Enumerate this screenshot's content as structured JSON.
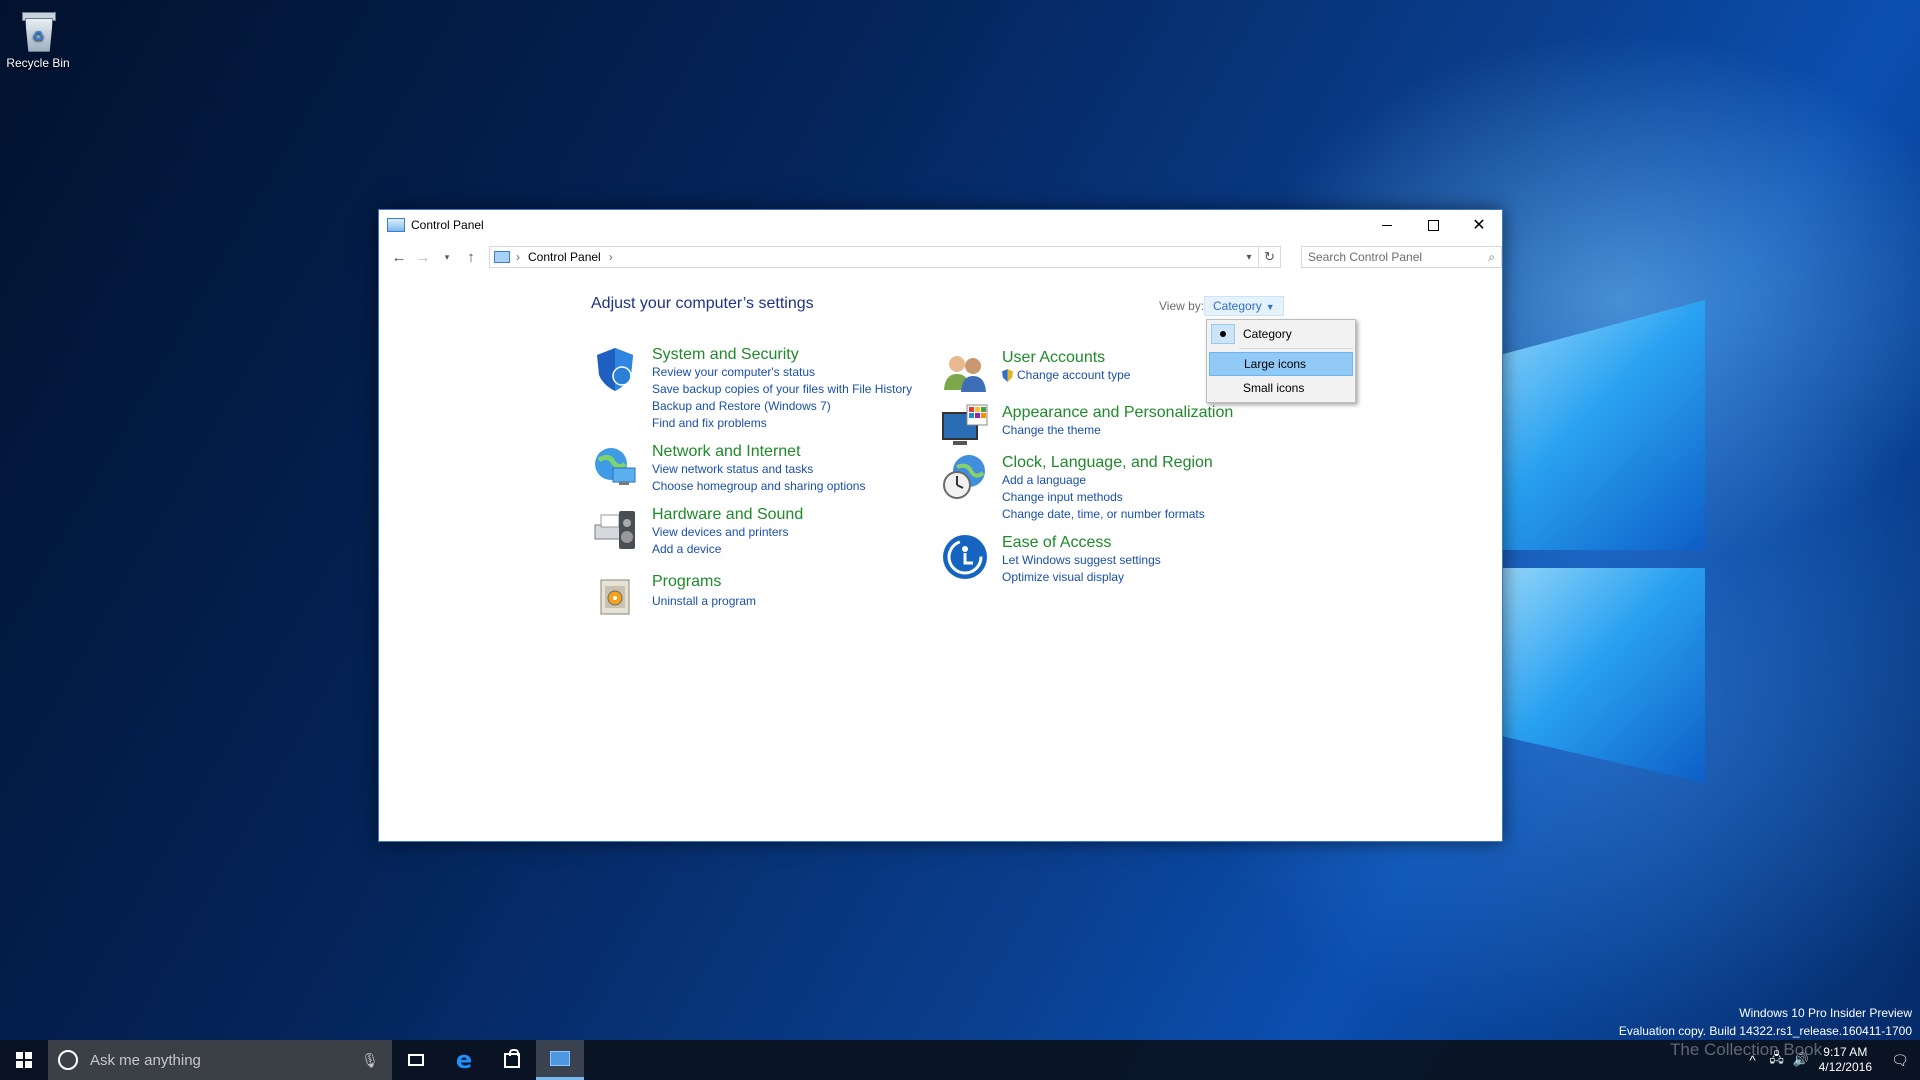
{
  "desktop": {
    "icons": [
      {
        "label": "Recycle Bin",
        "icon": "recycle-bin-icon"
      }
    ]
  },
  "window": {
    "title": "Control Panel",
    "search_placeholder": "Search Control Panel",
    "breadcrumb": [
      "Control Panel"
    ],
    "heading": "Adjust your computer’s settings",
    "view_by_label": "View by:",
    "view_by_value": "Category"
  },
  "categories": [
    {
      "title": "System and Security",
      "icon": "shield-icon",
      "links": [
        "Review your computer's status",
        "Save backup copies of your files with File History",
        "Backup and Restore (Windows 7)",
        "Find and fix problems"
      ]
    },
    {
      "title": "Network and Internet",
      "icon": "globe-network-icon",
      "links": [
        "View network status and tasks",
        "Choose homegroup and sharing options"
      ]
    },
    {
      "title": "Hardware and Sound",
      "icon": "printer-speaker-icon",
      "links": [
        "View devices and printers",
        "Add a device"
      ]
    },
    {
      "title": "Programs",
      "icon": "programs-icon",
      "links": [
        "Uninstall a program"
      ]
    },
    {
      "title": "User Accounts",
      "icon": "users-icon",
      "links": [
        "Change account type"
      ]
    },
    {
      "title": "Appearance and Personalization",
      "icon": "monitor-palette-icon",
      "links": [
        "Change the theme"
      ]
    },
    {
      "title": "Clock, Language, and Region",
      "icon": "clock-globe-icon",
      "links": [
        "Add a language",
        "Change input methods",
        "Change date, time, or number formats"
      ]
    },
    {
      "title": "Ease of Access",
      "icon": "ease-of-access-icon",
      "links": [
        "Let Windows suggest settings",
        "Optimize visual display"
      ]
    }
  ],
  "view_menu": {
    "items": [
      {
        "label": "Category",
        "checked": true
      },
      {
        "label": "Large icons",
        "hover": true
      },
      {
        "label": "Small icons"
      }
    ]
  },
  "taskbar": {
    "search_placeholder": "Ask me anything",
    "time": "9:17 AM",
    "date": "4/12/2016"
  },
  "watermark": {
    "line1": "Windows 10 Pro Insider Preview",
    "line2": "Evaluation copy. Build 14322.rs1_release.160411-1700",
    "overlay": "The Collection Book"
  },
  "colors": {
    "link": "#1a4fad",
    "category_title": "#1e8a2a",
    "heading": "#1e3287",
    "menu_highlight": "#91c9f7"
  }
}
